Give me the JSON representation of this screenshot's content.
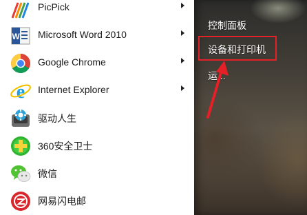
{
  "start_menu": {
    "programs": [
      {
        "label": "PicPick",
        "icon": "picpick-icon",
        "has_submenu": true
      },
      {
        "label": "Microsoft Word 2010",
        "icon": "word-icon",
        "has_submenu": true
      },
      {
        "label": "Google Chrome",
        "icon": "chrome-icon",
        "has_submenu": true
      },
      {
        "label": "Internet Explorer",
        "icon": "ie-icon",
        "has_submenu": true
      },
      {
        "label": "驱动人生",
        "icon": "driver-life-icon",
        "has_submenu": false
      },
      {
        "label": "360安全卫士",
        "icon": "360-security-icon",
        "has_submenu": false
      },
      {
        "label": "微信",
        "icon": "wechat-icon",
        "has_submenu": false
      },
      {
        "label": "网易闪电邮",
        "icon": "netease-mail-icon",
        "has_submenu": false
      }
    ],
    "right_pane": [
      {
        "label": "控制面板"
      },
      {
        "label": "设备和打印机"
      },
      {
        "label": "运..."
      }
    ]
  },
  "annotation": {
    "highlight_color": "#e52026"
  }
}
